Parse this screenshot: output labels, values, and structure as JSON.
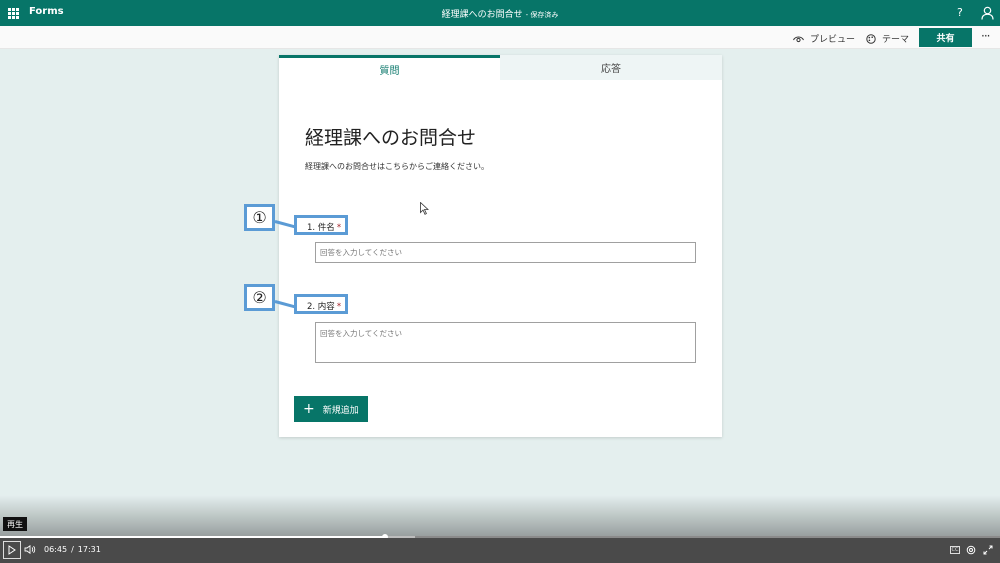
{
  "header": {
    "app_name": "Forms",
    "doc_title": "経理課へのお問合せ",
    "save_status": "- 保存済み",
    "help": "?"
  },
  "toolbar": {
    "preview_label": "プレビュー",
    "theme_label": "テーマ",
    "share_label": "共有",
    "more_label": "···"
  },
  "tabs": [
    {
      "label": "質問",
      "active": true
    },
    {
      "label": "応答",
      "active": false
    }
  ],
  "form": {
    "title": "経理課へのお問合せ",
    "description": "経理課へのお問合せはこちらからご連絡ください。",
    "questions": [
      {
        "label": "1. 件名",
        "required_mark": "*",
        "placeholder": "回答を入力してください"
      },
      {
        "label": "2. 内容",
        "required_mark": "*",
        "placeholder": "回答を入力してください"
      }
    ],
    "add_new_label": "新規追加"
  },
  "annotations": [
    {
      "number": "①"
    },
    {
      "number": "②"
    }
  ],
  "player": {
    "tooltip": "再生",
    "current_time": "06:45",
    "separator": "/",
    "total_time": "17:31",
    "progress_fraction": 0.385,
    "buffered_fraction": 0.415,
    "cc_label": "CC"
  },
  "colors": {
    "brand": "#077568",
    "annotation": "#5b9bd5",
    "background": "#e4efee"
  }
}
